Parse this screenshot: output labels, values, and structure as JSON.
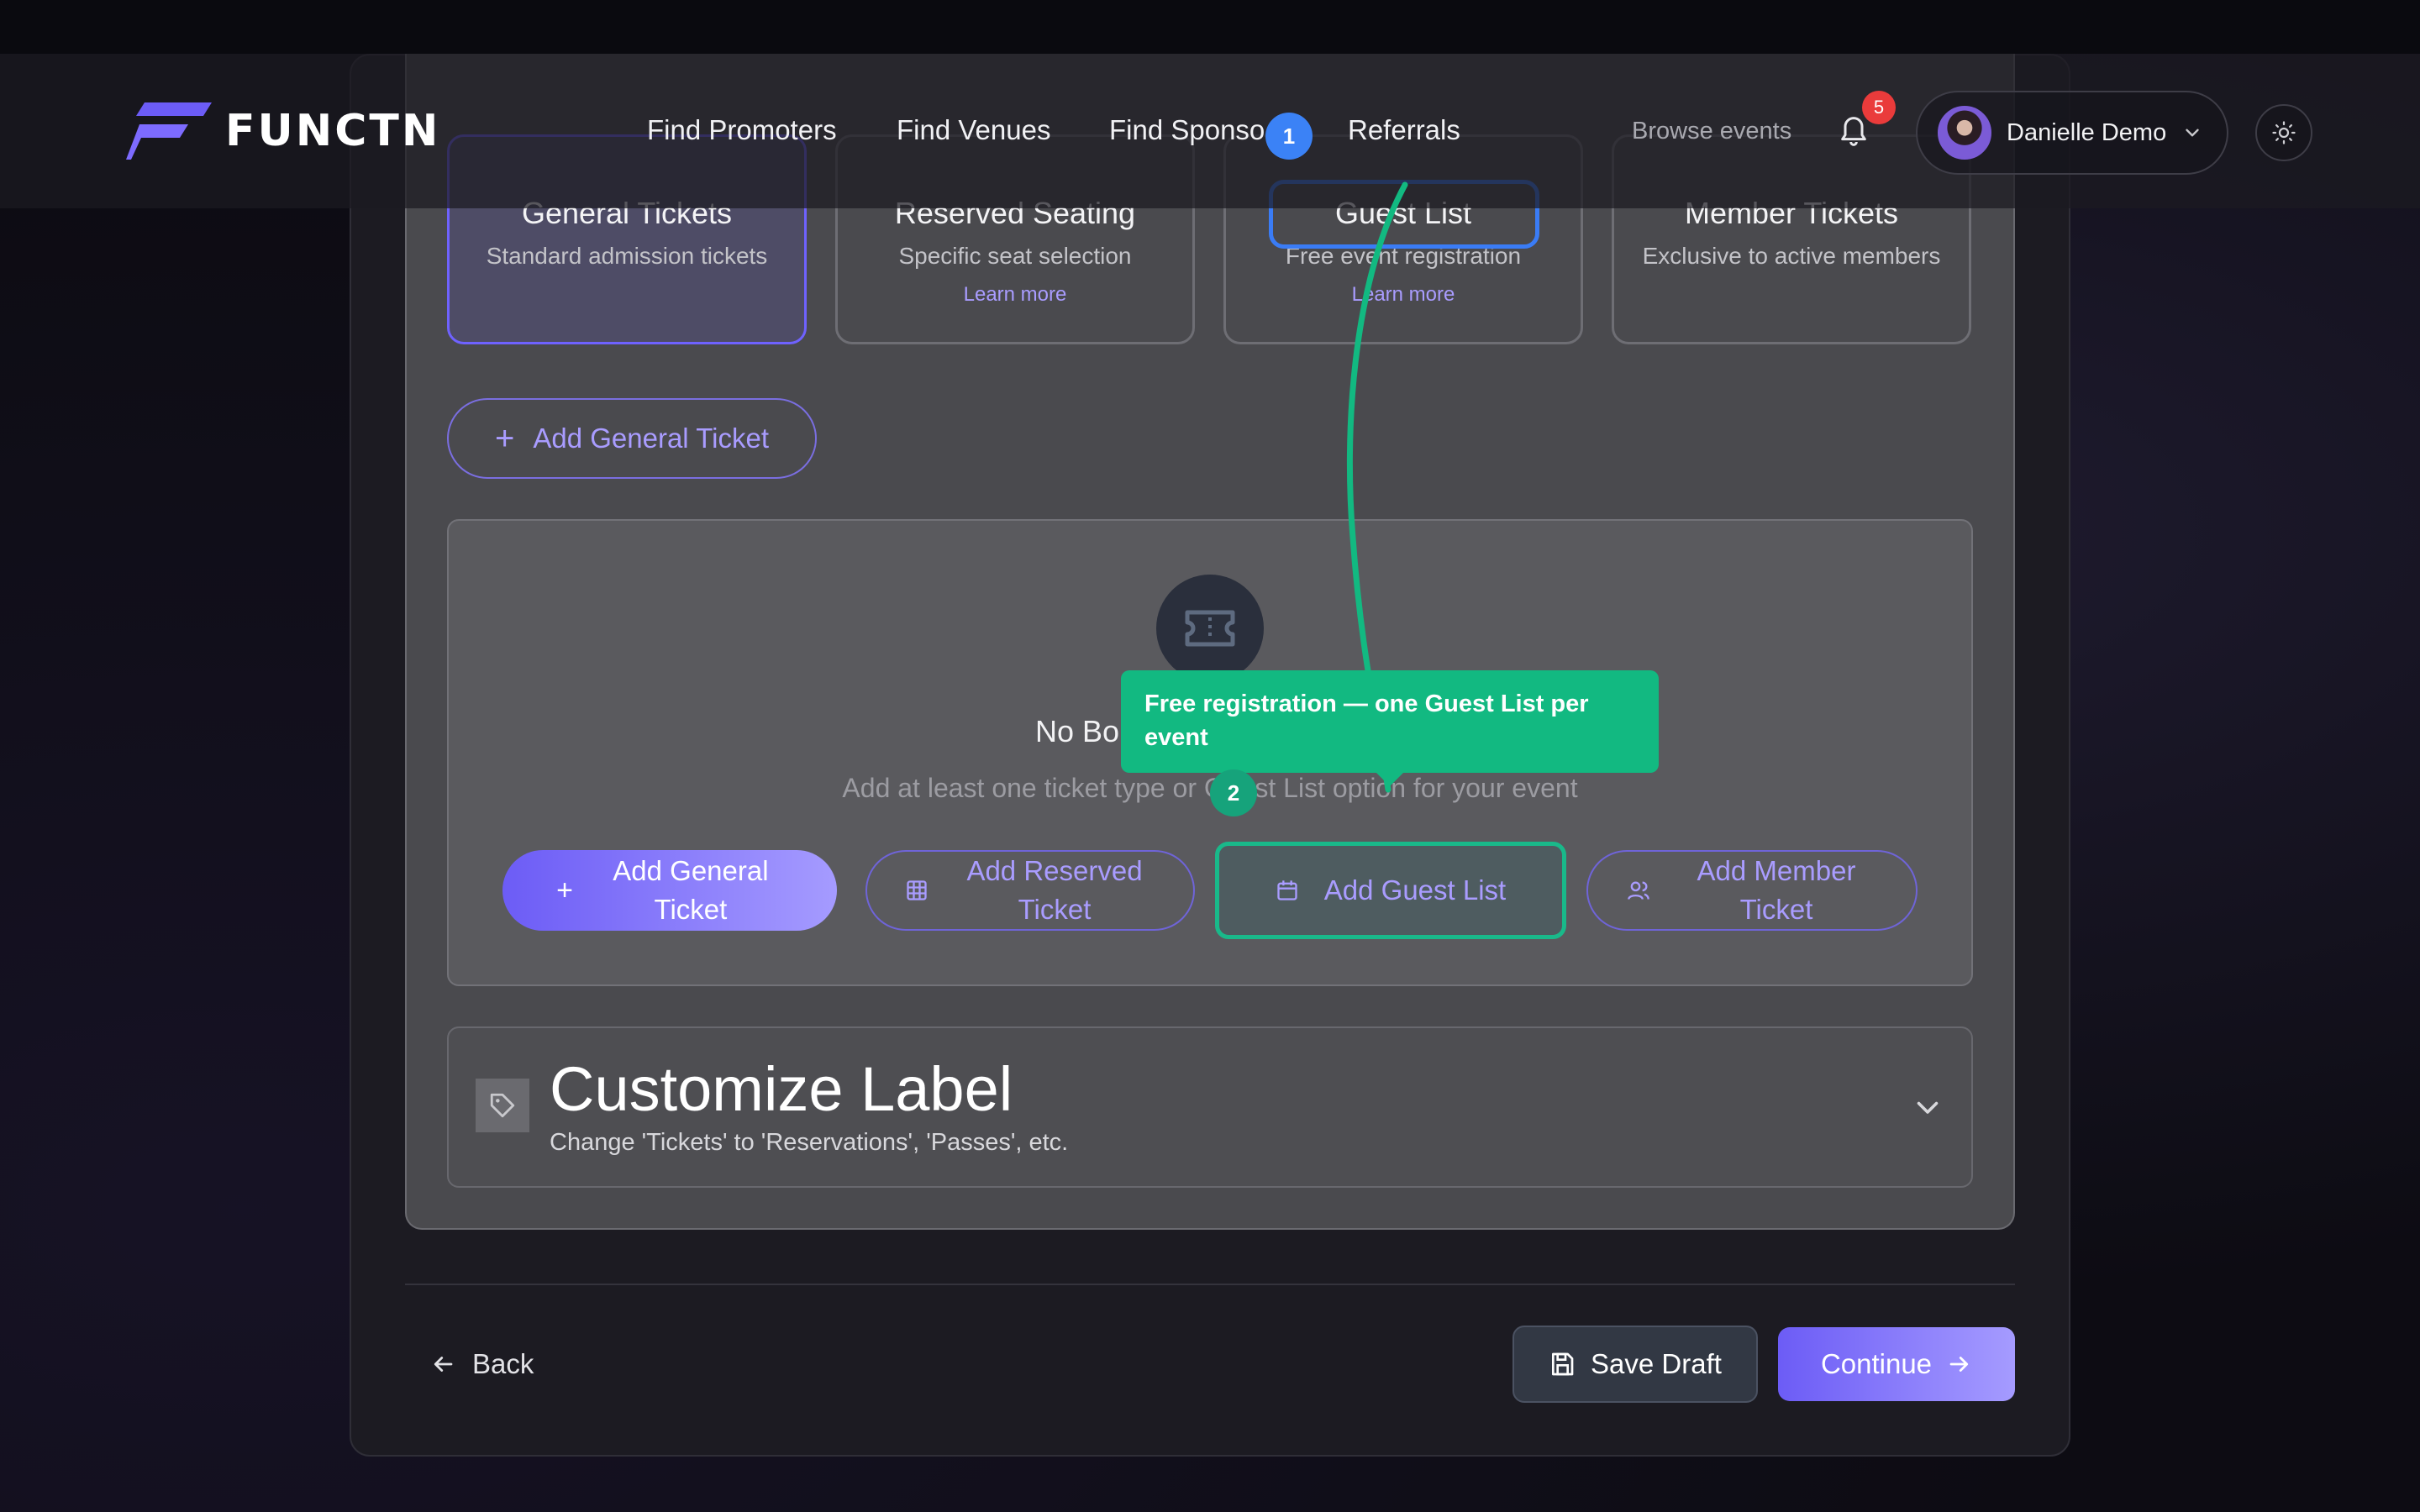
{
  "header": {
    "logo_text": "FUNCTN",
    "nav": [
      {
        "label": "Find Promoters"
      },
      {
        "label": "Find Venues"
      },
      {
        "label": "Find Sponso"
      },
      {
        "label": "Referrals"
      }
    ],
    "browse_label": "Browse events",
    "notification_count": "5",
    "user_name": "Danielle Demo"
  },
  "ticket_types": [
    {
      "title": "General Tickets",
      "subtitle": "Standard admission tickets",
      "selected": true
    },
    {
      "title": "Reserved Seating",
      "subtitle": "Specific seat selection",
      "link": "Learn more"
    },
    {
      "title": "Guest List",
      "subtitle": "Free event registration",
      "link": "Learn more"
    },
    {
      "title": "Member Tickets",
      "subtitle": "Exclusive to active members"
    }
  ],
  "add_general_pill": "Add General Ticket",
  "empty_state": {
    "title": "No Bo",
    "description": "Add at least one ticket type or Guest List option for your event",
    "buttons": {
      "general": "Add General Ticket",
      "reserved": "Add Reserved Ticket",
      "guest": "Add Guest List",
      "member": "Add Member Ticket"
    }
  },
  "customize": {
    "title": "Customize Label",
    "subtitle": "Change 'Tickets' to 'Reservations', 'Passes', etc."
  },
  "footer": {
    "back": "Back",
    "save_draft": "Save Draft",
    "continue": "Continue"
  },
  "tour": {
    "step1": "1",
    "step2": "2",
    "tooltip": "Free registration — one Guest List per event"
  },
  "colors": {
    "accent": "#6c5cf6",
    "tour_green": "#12b981",
    "tour_blue": "#3b82f6",
    "badge_red": "#ea3b3b"
  }
}
